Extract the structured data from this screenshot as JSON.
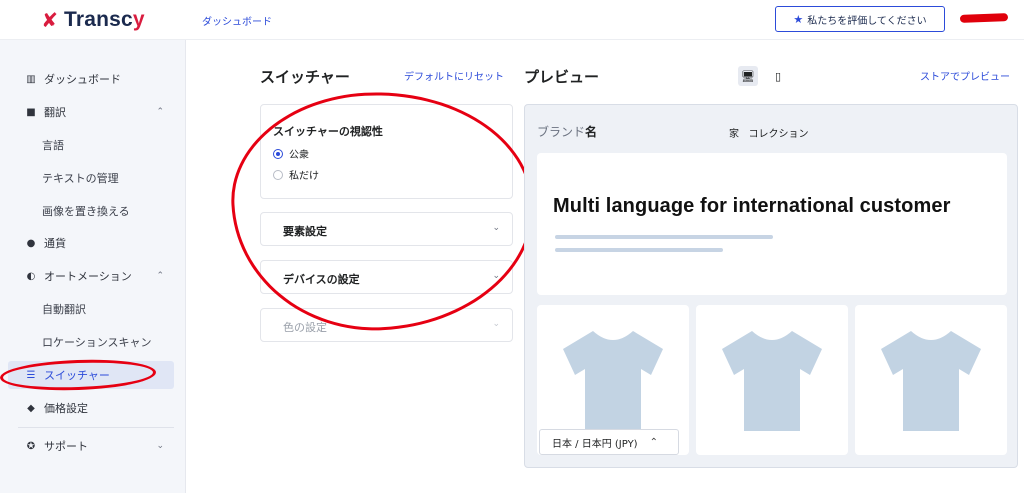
{
  "app": {
    "logo_text_main": "Transc",
    "logo_text_accent": "y",
    "logo_icon": "infinity-logo-icon"
  },
  "header": {
    "breadcrumb": "ダッシュボード",
    "rate_button": "私たちを評価してください",
    "rate_icon": "star-icon"
  },
  "sidebar": {
    "items": [
      {
        "label": "ダッシュボード",
        "icon": "chart-icon"
      },
      {
        "label": "翻訳",
        "icon": "translate-icon",
        "chevron": "⌃"
      },
      {
        "label": "言語"
      },
      {
        "label": "テキストの管理"
      },
      {
        "label": "画像を置き換える"
      },
      {
        "label": "通貨",
        "icon": "coins-icon"
      },
      {
        "label": "オートメーション",
        "icon": "toggle-icon",
        "chevron": "⌃"
      },
      {
        "label": "自動翻訳"
      },
      {
        "label": "ロケーションスキャン"
      },
      {
        "label": "スイッチャー",
        "icon": "sliders-icon",
        "active": true
      },
      {
        "label": "価格設定",
        "icon": "tag-icon"
      },
      {
        "label": "サポート",
        "icon": "support-icon",
        "chevron": "⌄"
      }
    ]
  },
  "switcher": {
    "title": "スイッチャー",
    "reset_link": "デフォルトにリセット",
    "visibility": {
      "title": "スイッチャーの視認性",
      "options": [
        {
          "label": "公衆",
          "selected": true
        },
        {
          "label": "私だけ",
          "selected": false
        }
      ]
    },
    "sections": [
      "要素設定",
      "デバイスの設定",
      "色の設定"
    ]
  },
  "preview": {
    "title": "プレビュー",
    "store_link": "ストアでプレビュー",
    "brand_prefix": "ブランド",
    "brand_bold": "名",
    "nav_home": "家",
    "nav_collection": "コレクション",
    "hero_title": "Multi language for international customer",
    "language_selector": "日本 / 日本円 (JPY)",
    "product_icon": "tshirt-icon",
    "product_count": 3
  },
  "colors": {
    "accent": "#2c4bd9",
    "brand_red": "#d91c3f",
    "annotation": "#e60012",
    "shirt": "#c2d3e3"
  }
}
